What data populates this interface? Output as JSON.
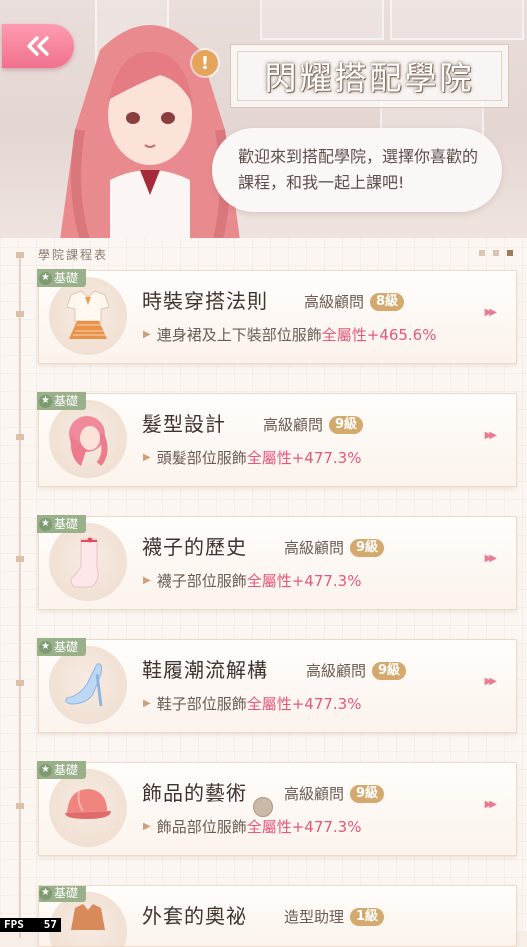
{
  "header": {
    "title": "閃耀搭配學院",
    "speech": "歡迎來到搭配學院，選擇你喜歡的課程，和我一起上課吧!"
  },
  "schedule": {
    "label": "學院課程表",
    "page_dots": 3,
    "active_dot": 3
  },
  "courses": [
    {
      "badge": "基礎",
      "name": "時裝穿搭法則",
      "rank": "高級顧問",
      "level": "8級",
      "desc_prefix": "連身裙及上下裝部位服飾",
      "desc_highlight": "全屬性+465.6%",
      "icon": "clothing-icon"
    },
    {
      "badge": "基礎",
      "name": "髮型設計",
      "rank": "高級顧問",
      "level": "9級",
      "desc_prefix": "頭髮部位服飾",
      "desc_highlight": "全屬性+477.3%",
      "icon": "hair-icon"
    },
    {
      "badge": "基礎",
      "name": "襪子的歷史",
      "rank": "高級顧問",
      "level": "9級",
      "desc_prefix": "襪子部位服飾",
      "desc_highlight": "全屬性+477.3%",
      "icon": "sock-icon"
    },
    {
      "badge": "基礎",
      "name": "鞋履潮流解構",
      "rank": "高級顧問",
      "level": "9級",
      "desc_prefix": "鞋子部位服飾",
      "desc_highlight": "全屬性+477.3%",
      "icon": "shoe-icon"
    },
    {
      "badge": "基礎",
      "name": "飾品的藝術",
      "rank": "高級顧問",
      "level": "9級",
      "desc_prefix": "飾品部位服飾",
      "desc_highlight": "全屬性+477.3%",
      "icon": "hat-icon"
    },
    {
      "badge": "基礎",
      "name": "外套的奧祕",
      "rank": "造型助理",
      "level": "1級",
      "desc_prefix": "",
      "desc_highlight": "",
      "icon": "coat-icon"
    }
  ],
  "fps": {
    "label": "FPS",
    "value": "57"
  },
  "colors": {
    "accent": "#e8577a",
    "badge": "#9ab08b",
    "level": "#d3a96d",
    "back_button": "#f0718d"
  }
}
